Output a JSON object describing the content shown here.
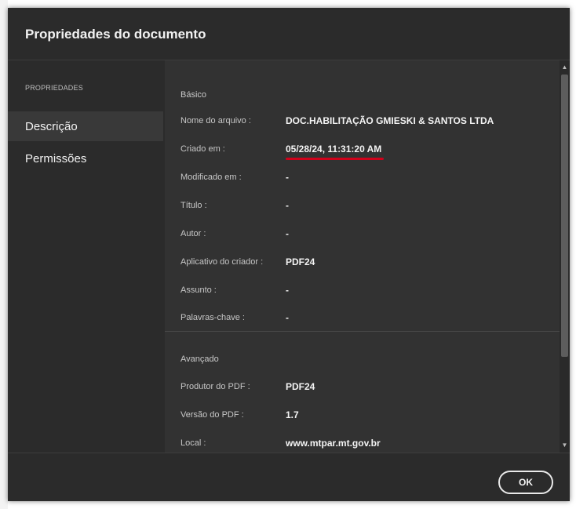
{
  "dialog": {
    "title": "Propriedades do documento"
  },
  "sidebar": {
    "heading": "PROPRIEDADES",
    "items": [
      {
        "label": "Descrição",
        "active": true
      },
      {
        "label": "Permissões",
        "active": false
      }
    ]
  },
  "basic": {
    "heading": "Básico",
    "rows": [
      {
        "label": "Nome do arquivo :",
        "value": "DOC.HABILITAÇÃO GMIESKI & SANTOS LTDA"
      },
      {
        "label": "Criado em :",
        "value": "05/28/24, 11:31:20 AM"
      },
      {
        "label": "Modificado em :",
        "value": "-"
      },
      {
        "label": "Título :",
        "value": "-"
      },
      {
        "label": "Autor :",
        "value": "-"
      },
      {
        "label": "Aplicativo do criador :",
        "value": "PDF24"
      },
      {
        "label": "Assunto :",
        "value": "-"
      },
      {
        "label": "Palavras-chave :",
        "value": "-"
      }
    ]
  },
  "advanced": {
    "heading": "Avançado",
    "rows": [
      {
        "label": "Produtor do PDF :",
        "value": "PDF24"
      },
      {
        "label": "Versão do PDF :",
        "value": "1.7"
      },
      {
        "label": "Local :",
        "value": "www.mtpar.mt.gov.br"
      }
    ]
  },
  "footer": {
    "ok_label": "OK"
  },
  "colors": {
    "dialog_bg": "#2b2b2b",
    "content_bg": "#323232",
    "annotation_red": "#d0021b"
  }
}
